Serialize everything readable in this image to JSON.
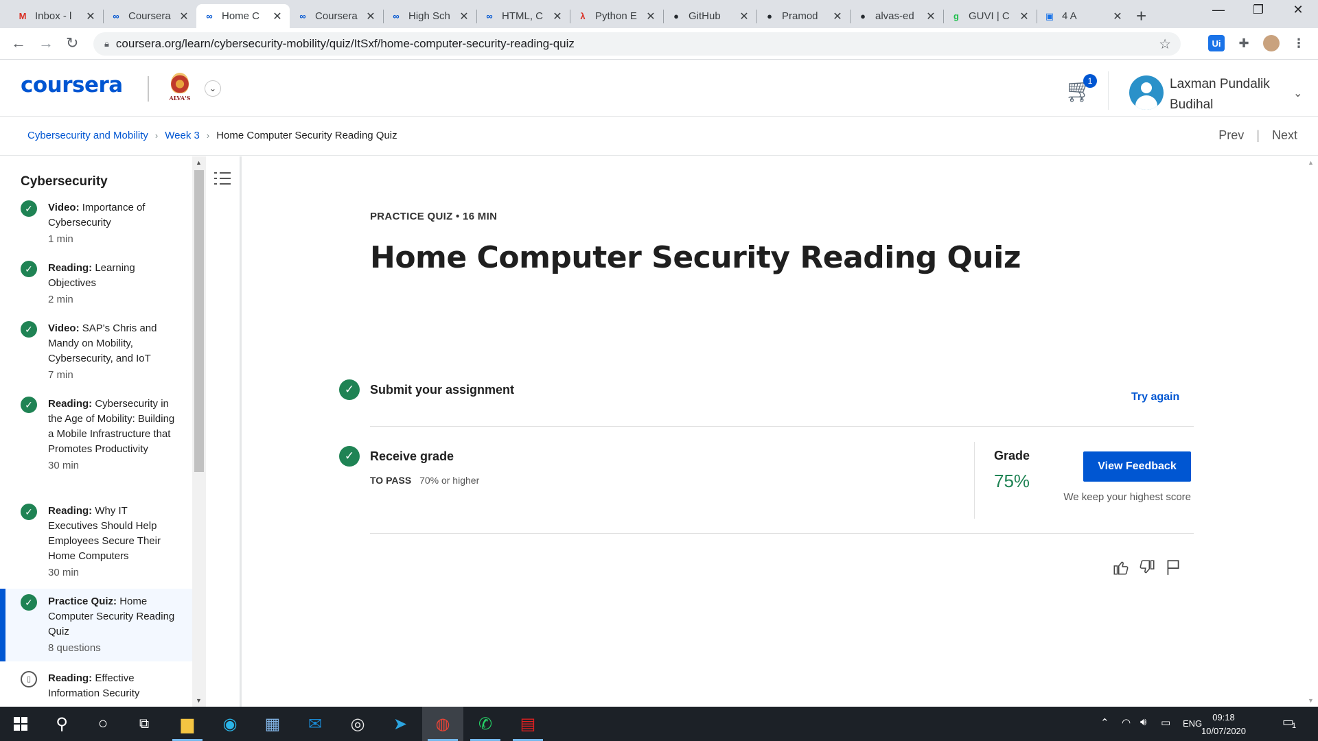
{
  "browser": {
    "tabs": [
      {
        "label": "Inbox - l",
        "icon": "gmail-icon",
        "icon_char": "M",
        "icon_color": "#d93025",
        "active": false
      },
      {
        "label": "Coursera",
        "icon": "coursera-icon",
        "icon_char": "∞",
        "icon_color": "#0056d2",
        "active": false
      },
      {
        "label": "Home C",
        "icon": "coursera-icon",
        "icon_char": "∞",
        "icon_color": "#0056d2",
        "active": true
      },
      {
        "label": "Coursera",
        "icon": "coursera-icon",
        "icon_char": "∞",
        "icon_color": "#0056d2",
        "active": false
      },
      {
        "label": "High Sch",
        "icon": "coursera-icon",
        "icon_char": "∞",
        "icon_color": "#0056d2",
        "active": false
      },
      {
        "label": "HTML, C",
        "icon": "coursera-icon",
        "icon_char": "∞",
        "icon_color": "#0056d2",
        "active": false
      },
      {
        "label": "Python E",
        "icon": "pdf-icon",
        "icon_char": "λ",
        "icon_color": "#d93025",
        "active": false
      },
      {
        "label": "GitHub",
        "icon": "github-icon",
        "icon_char": "●",
        "icon_color": "#24292e",
        "active": false
      },
      {
        "label": "Pramod",
        "icon": "github-icon",
        "icon_char": "●",
        "icon_color": "#24292e",
        "active": false
      },
      {
        "label": "alvas-ed",
        "icon": "github-icon",
        "icon_char": "●",
        "icon_color": "#24292e",
        "active": false
      },
      {
        "label": "GUVI | C",
        "icon": "guvi-icon",
        "icon_char": "g",
        "icon_color": "#1fbf4c",
        "active": false
      },
      {
        "label": "4 A",
        "icon": "contacts-icon",
        "icon_char": "▣",
        "icon_color": "#1a73e8",
        "active": false
      }
    ],
    "url": "coursera.org/learn/cybersecurity-mobility/quiz/ItSxf/home-computer-security-reading-quiz",
    "close_glyph": "✕",
    "new_tab_glyph": "+"
  },
  "header": {
    "logo": "coursera",
    "org_logo_text": "ALVA'S",
    "cart_count": "1",
    "user_name": "Laxman Pundalik Budihal"
  },
  "breadcrumb": {
    "items": [
      "Cybersecurity and Mobility",
      "Week 3"
    ],
    "current": "Home Computer Security Reading Quiz",
    "prev": "Prev",
    "next": "Next",
    "separator": "|"
  },
  "sidebar": {
    "title": "Cybersecurity",
    "lessons": [
      {
        "type": "Video:",
        "title": "Importance of Cybersecurity",
        "meta": "1 min",
        "done": true
      },
      {
        "type": "Reading:",
        "title": "Learning Objectives",
        "meta": "2 min",
        "done": true
      },
      {
        "type": "Video:",
        "title": "SAP's Chris and Mandy on Mobility, Cybersecurity, and IoT",
        "meta": "7 min",
        "done": true
      },
      {
        "type": "Reading:",
        "title": "Cybersecurity in the Age of Mobility: Building a Mobile Infrastructure that Promotes Productivity",
        "meta": "30 min",
        "done": true
      },
      {
        "type": "Reading:",
        "title": "Why IT Executives Should Help Employees Secure Their Home Computers",
        "meta": "30 min",
        "done": true
      },
      {
        "type": "Practice Quiz:",
        "title": "Home Computer Security Reading Quiz",
        "meta": "8 questions",
        "done": true,
        "active": true
      },
      {
        "type": "Reading:",
        "title": "Effective Information Security",
        "meta": "",
        "done": false
      }
    ]
  },
  "quiz": {
    "eyebrow": "PRACTICE QUIZ • 16 MIN",
    "title": "Home Computer Security Reading Quiz",
    "step1": "Submit your assignment",
    "try_again": "Try again",
    "step2": "Receive grade",
    "to_pass_label": "TO PASS",
    "to_pass_value": "70% or higher",
    "grade_label": "Grade",
    "grade_value": "75%",
    "view_feedback": "View Feedback",
    "keep_note": "We keep your highest score"
  },
  "taskbar": {
    "lang": "ENG",
    "time": "09:18",
    "date": "10/07/2020",
    "notif_count": "1"
  },
  "colors": {
    "brand": "#0056d2",
    "success": "#1f8354"
  }
}
